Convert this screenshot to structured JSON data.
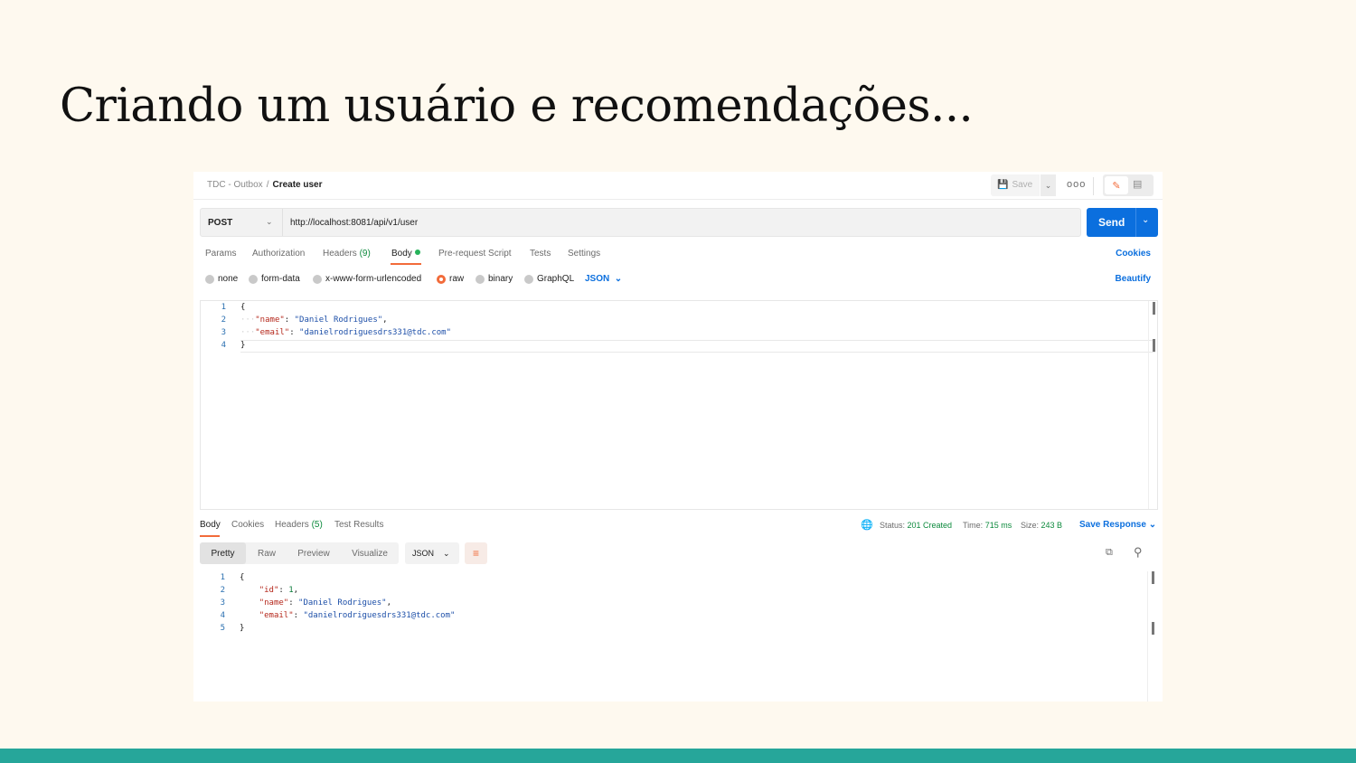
{
  "slide": {
    "title": "Criando um usuário e recomendações..."
  },
  "breadcrumb": {
    "collection": "TDC - Outbox",
    "separator": "/",
    "request": "Create user"
  },
  "toolbar": {
    "save_label": "Save",
    "more_label": "ooo"
  },
  "request": {
    "method": "POST",
    "url": "http://localhost:8081/api/v1/user",
    "send_label": "Send"
  },
  "tabs": {
    "params": "Params",
    "authorization": "Authorization",
    "headers": "Headers",
    "headers_count": "(9)",
    "body": "Body",
    "prerequest": "Pre-request Script",
    "tests": "Tests",
    "settings": "Settings",
    "cookies": "Cookies"
  },
  "body_types": {
    "none": "none",
    "form_data": "form-data",
    "urlencoded": "x-www-form-urlencoded",
    "raw": "raw",
    "binary": "binary",
    "graphql": "GraphQL",
    "format": "JSON",
    "beautify": "Beautify"
  },
  "request_body": {
    "lines": [
      "1",
      "2",
      "3",
      "4"
    ],
    "open_brace": "{",
    "name_key": "\"name\"",
    "name_value": "\"Daniel Rodrigues\"",
    "email_key": "\"email\"",
    "email_value": "\"danielrodriguesdrs331@tdc.com\"",
    "close_brace": "}"
  },
  "response": {
    "tabs": {
      "body": "Body",
      "cookies": "Cookies",
      "headers": "Headers",
      "headers_count": "(5)",
      "test_results": "Test Results"
    },
    "status_label": "Status:",
    "status_value": "201 Created",
    "time_label": "Time:",
    "time_value": "715 ms",
    "size_label": "Size:",
    "size_value": "243 B",
    "save_response": "Save Response",
    "views": {
      "pretty": "Pretty",
      "raw": "Raw",
      "preview": "Preview",
      "visualize": "Visualize"
    },
    "format": "JSON",
    "body": {
      "lines": [
        "1",
        "2",
        "3",
        "4",
        "5"
      ],
      "open_brace": "{",
      "id_key": "\"id\"",
      "id_value": "1",
      "name_key": "\"name\"",
      "name_value": "\"Daniel Rodrigues\"",
      "email_key": "\"email\"",
      "email_value": "\"danielrodriguesdrs331@tdc.com\"",
      "close_brace": "}"
    }
  },
  "colors": {
    "accent": "#f26b3a",
    "primary": "#0b6fde",
    "success": "#0d8a3d",
    "background": "#fef9ef",
    "footer_bar": "#26a69a"
  }
}
